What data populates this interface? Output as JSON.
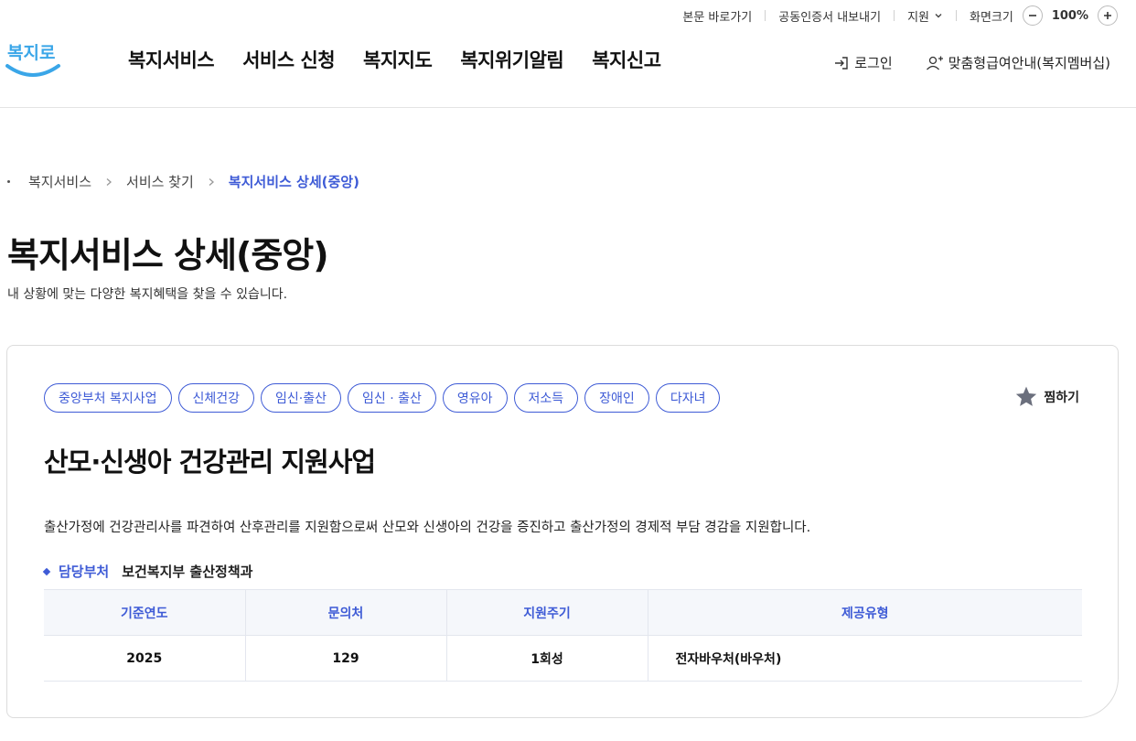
{
  "utility": {
    "skip_to_content": "본문 바로가기",
    "cert_export": "공동인증서 내보내기",
    "support": "지원",
    "screen_size": "화면크기",
    "zoom_level": "100%"
  },
  "header": {
    "logo_text": "복지로",
    "nav": [
      "복지서비스",
      "서비스 신청",
      "복지지도",
      "복지위기알림",
      "복지신고"
    ],
    "login": "로그인",
    "membership": "맞춤형급여안내(복지멤버십)"
  },
  "breadcrumb": [
    "복지서비스",
    "서비스 찾기",
    "복지서비스 상세(중앙)"
  ],
  "page": {
    "title": "복지서비스 상세(중앙)",
    "description": "내 상황에 맞는 다양한 복지혜택을 찾을 수 있습니다."
  },
  "service": {
    "tags": [
      "중앙부처 복지사업",
      "신체건강",
      "임신·출산",
      "임신 · 출산",
      "영유아",
      "저소득",
      "장애인",
      "다자녀"
    ],
    "favorite_label": "찜하기",
    "title": "산모·신생아 건강관리 지원사업",
    "description": "출산가정에 건강관리사를 파견하여 산후관리를 지원함으로써 산모와 신생아의 건강을 증진하고 출산가정의 경제적 부담 경감을 지원합니다.",
    "department_label": "담당부처",
    "department_value": "보건복지부 출산정책과",
    "table": {
      "headers": [
        "기준연도",
        "문의처",
        "지원주기",
        "제공유형"
      ],
      "row": [
        "2025",
        "129",
        "1회성",
        "전자바우처(바우처)"
      ]
    }
  },
  "colors": {
    "accent": "#3e5bd6",
    "logo_blue": "#3aa6e8",
    "star": "#6b6f7d"
  }
}
